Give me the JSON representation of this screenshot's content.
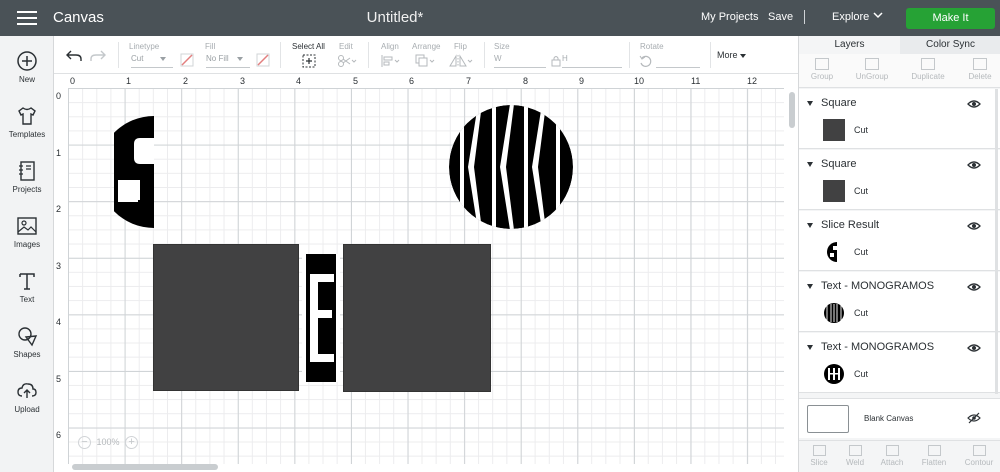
{
  "header": {
    "app_name": "Canvas",
    "doc_title": "Untitled*",
    "my_projects": "My Projects",
    "save": "Save",
    "separator": "|",
    "explore": "Explore",
    "make_it": "Make It"
  },
  "sidebar": {
    "items": [
      {
        "label": "New",
        "icon": "plus-circle-icon"
      },
      {
        "label": "Templates",
        "icon": "shirt-icon"
      },
      {
        "label": "Projects",
        "icon": "notebook-icon"
      },
      {
        "label": "Images",
        "icon": "image-icon"
      },
      {
        "label": "Text",
        "icon": "text-icon"
      },
      {
        "label": "Shapes",
        "icon": "shapes-icon"
      },
      {
        "label": "Upload",
        "icon": "upload-icon"
      }
    ]
  },
  "toolbar": {
    "linetype_label": "Linetype",
    "linetype_value": "Cut",
    "fill_label": "Fill",
    "fill_value": "No Fill",
    "select_all": "Select All",
    "edit": "Edit",
    "align": "Align",
    "arrange": "Arrange",
    "flip": "Flip",
    "size": "Size",
    "size_w": "W",
    "size_h": "H",
    "rotate": "Rotate",
    "more": "More"
  },
  "canvas": {
    "ruler_top": [
      "0",
      "1",
      "2",
      "3",
      "4",
      "5",
      "6",
      "7",
      "8",
      "9",
      "10",
      "11",
      "12"
    ],
    "ruler_left": [
      "0",
      "1",
      "2",
      "3",
      "4",
      "5",
      "6"
    ],
    "zoom": "100%",
    "zoom_minus": "−",
    "zoom_plus": "+",
    "monogram_kkk": "KKK",
    "monogram_s": "S",
    "monogram_e": "E",
    "shape_color": "#414142"
  },
  "panel": {
    "tabs": [
      "Layers",
      "Color Sync"
    ],
    "tools": [
      "Group",
      "UnGroup",
      "Duplicate",
      "Delete"
    ],
    "layers": [
      {
        "name": "Square",
        "sub": "Cut",
        "thumb": "square"
      },
      {
        "name": "Square",
        "sub": "Cut",
        "thumb": "square"
      },
      {
        "name": "Slice Result",
        "sub": "Cut",
        "thumb": "S"
      },
      {
        "name": "Text - MONOGRAMOS",
        "sub": "Cut",
        "thumb": "KKK"
      },
      {
        "name": "Text - MONOGRAMOS",
        "sub": "Cut",
        "thumb": "EEE"
      }
    ],
    "blank_canvas": "Blank Canvas",
    "bottom_tools": [
      "Slice",
      "Weld",
      "Attach",
      "Flatten",
      "Contour"
    ]
  },
  "colors": {
    "topbar": "#4a5257",
    "make_it": "#26a235",
    "ink": "#000000"
  }
}
